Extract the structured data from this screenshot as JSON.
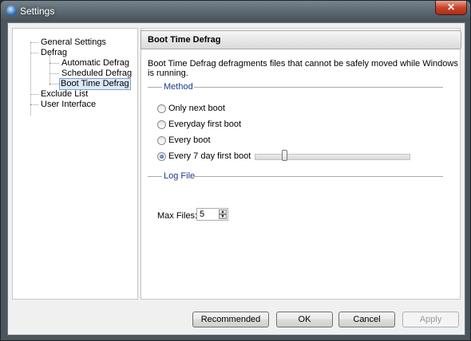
{
  "window": {
    "title": "Settings",
    "close_glyph": "✕"
  },
  "tree": {
    "items": [
      {
        "label": "General Settings"
      },
      {
        "label": "Defrag"
      },
      {
        "label": "Automatic Defrag"
      },
      {
        "label": "Scheduled Defrag"
      },
      {
        "label": "Boot Time Defrag",
        "selected": true
      },
      {
        "label": "Exclude List"
      },
      {
        "label": "User Interface"
      }
    ],
    "expander_glyph": "−"
  },
  "panel": {
    "title": "Boot Time Defrag",
    "description": "Boot Time Defrag defragments files that cannot be safely moved while Windows is running."
  },
  "method": {
    "label": "Method",
    "options": [
      {
        "label": "Only next boot",
        "checked": false
      },
      {
        "label": "Everyday first boot",
        "checked": false
      },
      {
        "label": "Every boot",
        "checked": false
      },
      {
        "label": "Every 7 day first boot",
        "checked": true
      }
    ],
    "slider_level": 0.18
  },
  "logfile": {
    "label": "Log File",
    "max_files_label": "Max Files:",
    "max_files_value": "5"
  },
  "buttons": {
    "recommended": "Recommended",
    "ok": "OK",
    "cancel": "Cancel",
    "apply": "Apply"
  }
}
